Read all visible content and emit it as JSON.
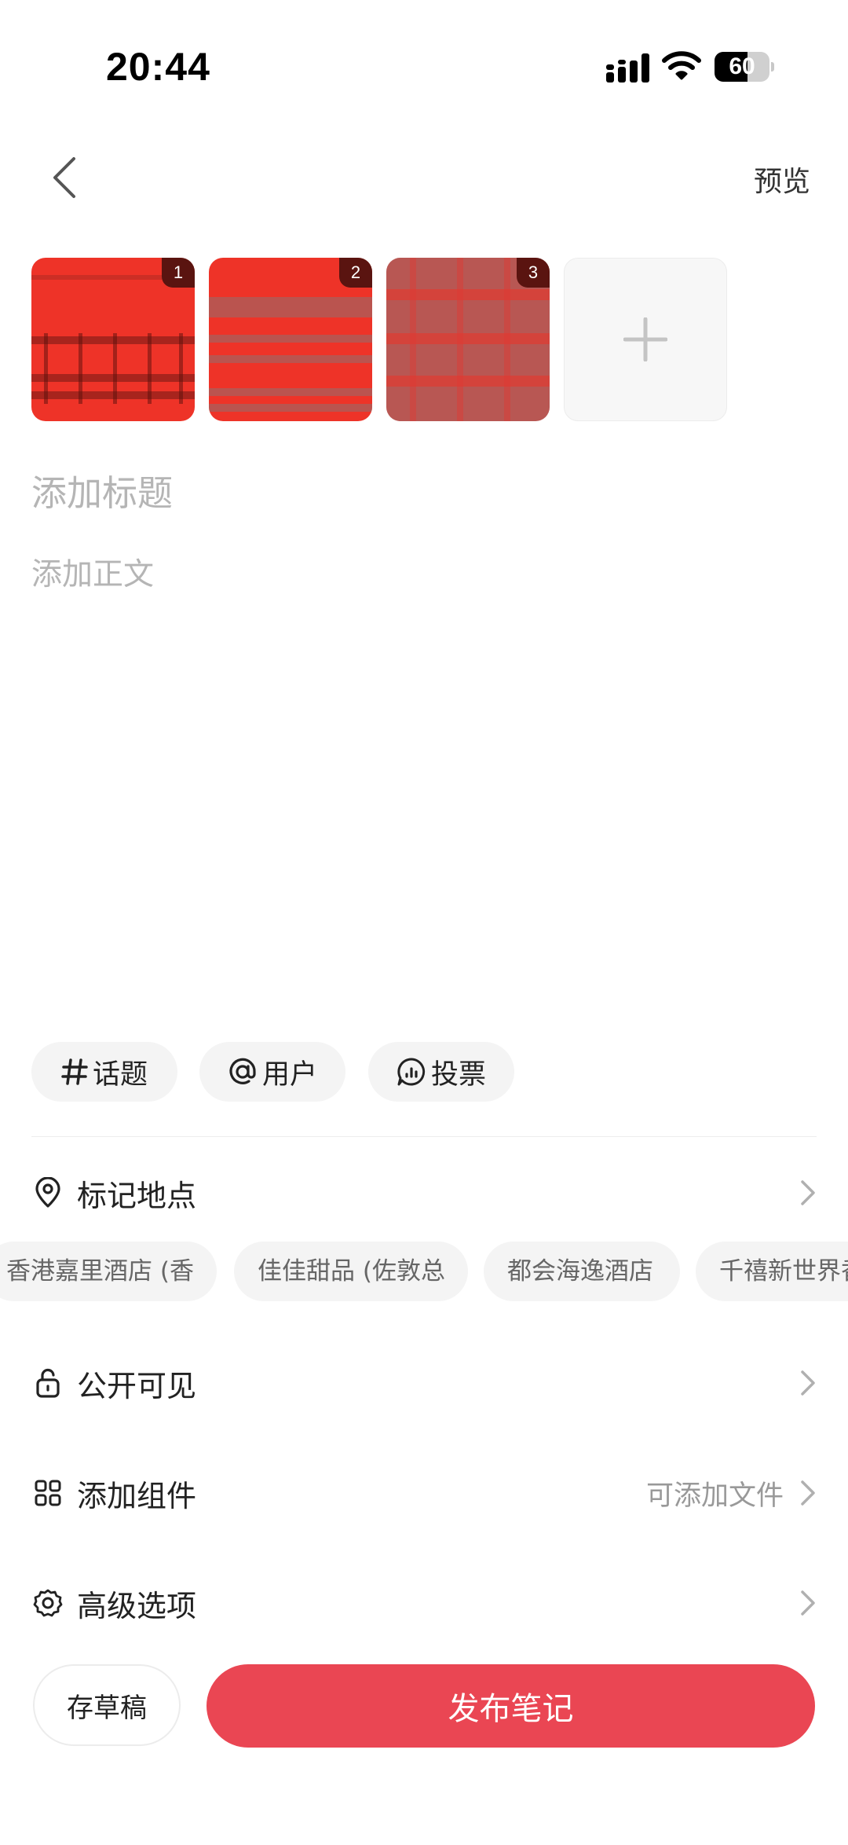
{
  "status_bar": {
    "time": "20:44",
    "battery_level": "60",
    "battery_fraction": 0.6,
    "icons": [
      "signal-icon",
      "wifi-icon",
      "battery-icon"
    ]
  },
  "nav": {
    "back_icon": "chevron-left-icon",
    "preview_label": "预览"
  },
  "images": {
    "thumbnails": [
      {
        "badge": "1",
        "accent": "#ee3328"
      },
      {
        "badge": "2",
        "accent": "#ee3328"
      },
      {
        "badge": "3",
        "accent": "#c84a44"
      }
    ],
    "add_icon": "plus-icon"
  },
  "editor": {
    "title_placeholder": "添加标题",
    "body_placeholder": "添加正文"
  },
  "chips": {
    "topic": {
      "icon": "hash-icon",
      "label": "话题"
    },
    "user": {
      "icon": "at-icon",
      "label": "用户"
    },
    "vote": {
      "icon": "vote-icon",
      "label": "投票"
    }
  },
  "location": {
    "icon": "location-pin-icon",
    "label": "标记地点",
    "suggestions": [
      "香港嘉里酒店 (香",
      "佳佳甜品 (佐敦总",
      "都会海逸酒店",
      "千禧新世界香"
    ]
  },
  "settings": {
    "visibility": {
      "icon": "lock-icon",
      "label": "公开可见"
    },
    "components": {
      "icon": "grid-icon",
      "label": "添加组件",
      "value": "可添加文件"
    },
    "advanced": {
      "icon": "gear-icon",
      "label": "高级选项"
    }
  },
  "footer": {
    "draft_label": "存草稿",
    "publish_label": "发布笔记"
  },
  "colors": {
    "accent": "#ea4653",
    "chip_bg": "#f4f4f4",
    "placeholder": "#b5b5b5"
  }
}
